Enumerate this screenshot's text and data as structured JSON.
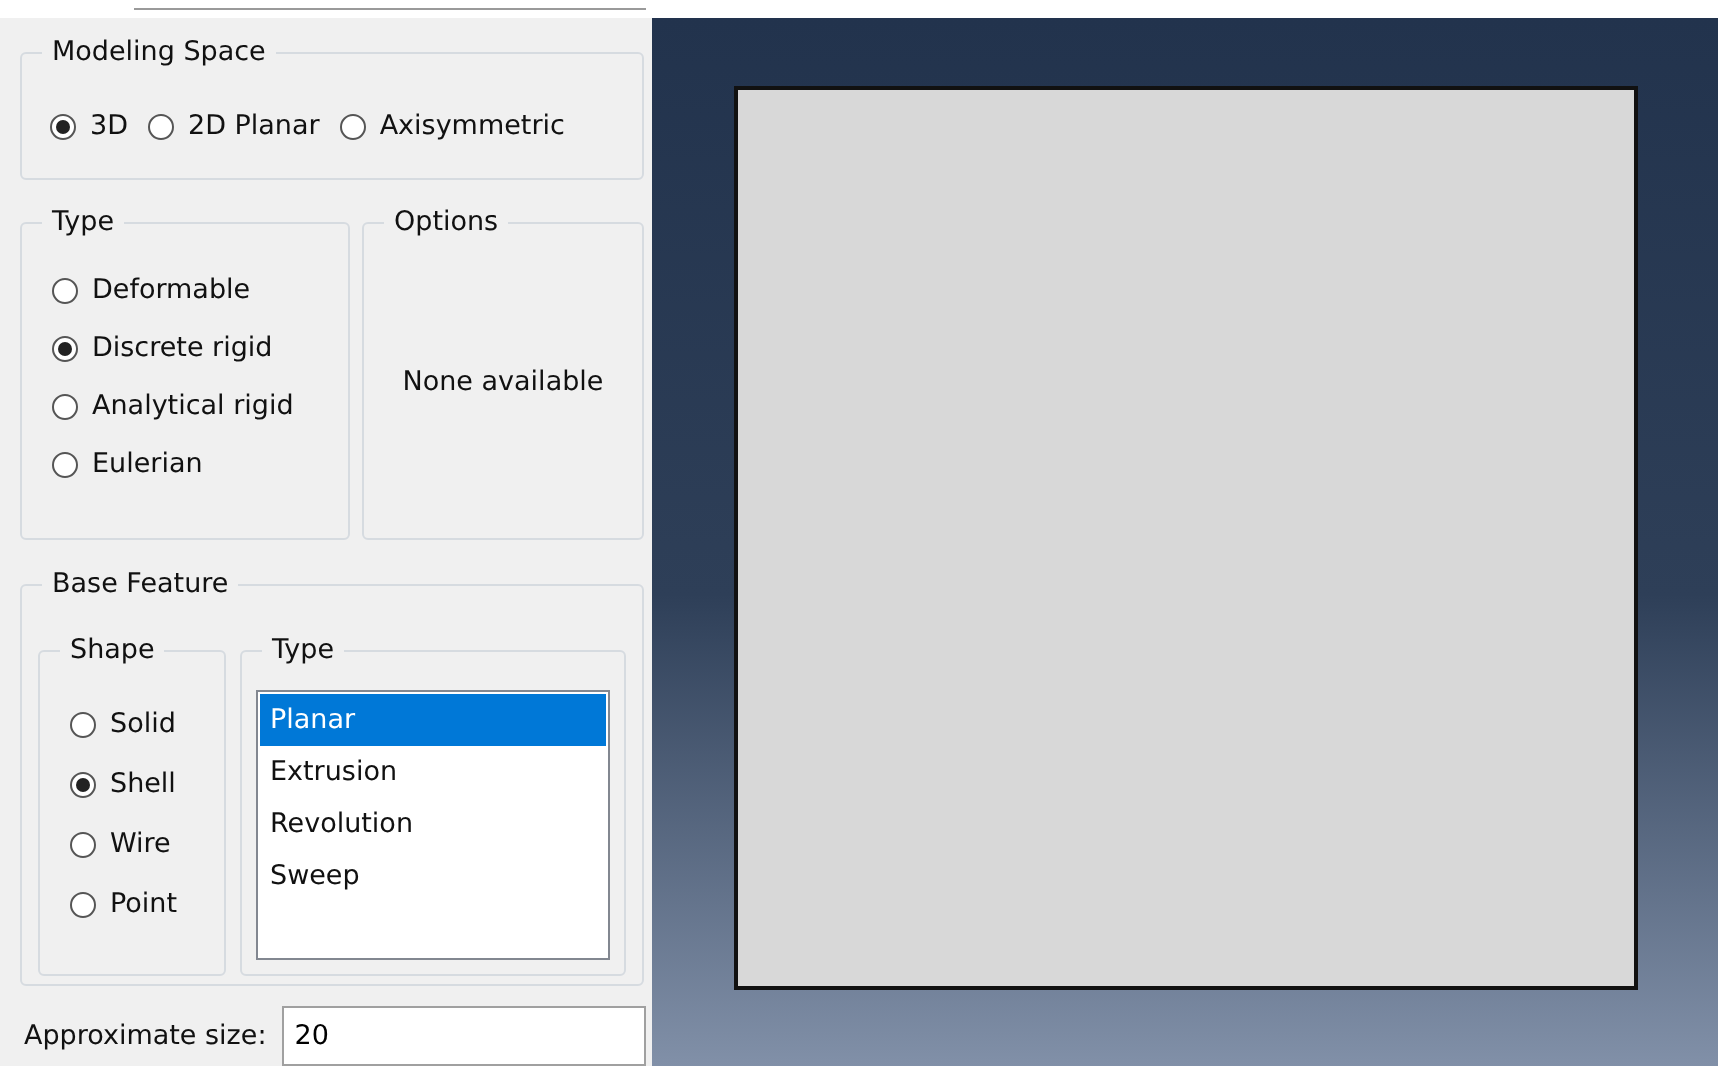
{
  "modeling_space": {
    "title": "Modeling Space",
    "options": [
      {
        "label": "3D",
        "selected": true
      },
      {
        "label": "2D Planar",
        "selected": false
      },
      {
        "label": "Axisymmetric",
        "selected": false
      }
    ]
  },
  "type": {
    "title": "Type",
    "options": [
      {
        "label": "Deformable",
        "selected": false
      },
      {
        "label": "Discrete rigid",
        "selected": true
      },
      {
        "label": "Analytical rigid",
        "selected": false
      },
      {
        "label": "Eulerian",
        "selected": false
      }
    ]
  },
  "options": {
    "title": "Options",
    "message": "None available"
  },
  "base_feature": {
    "title": "Base Feature",
    "shape": {
      "title": "Shape",
      "options": [
        {
          "label": "Solid",
          "selected": false
        },
        {
          "label": "Shell",
          "selected": true
        },
        {
          "label": "Wire",
          "selected": false
        },
        {
          "label": "Point",
          "selected": false
        }
      ]
    },
    "type": {
      "title": "Type",
      "items": [
        {
          "label": "Planar",
          "selected": true
        },
        {
          "label": "Extrusion",
          "selected": false
        },
        {
          "label": "Revolution",
          "selected": false
        },
        {
          "label": "Sweep",
          "selected": false
        }
      ]
    }
  },
  "approximate_size": {
    "label": "Approximate size:",
    "value": "20"
  }
}
